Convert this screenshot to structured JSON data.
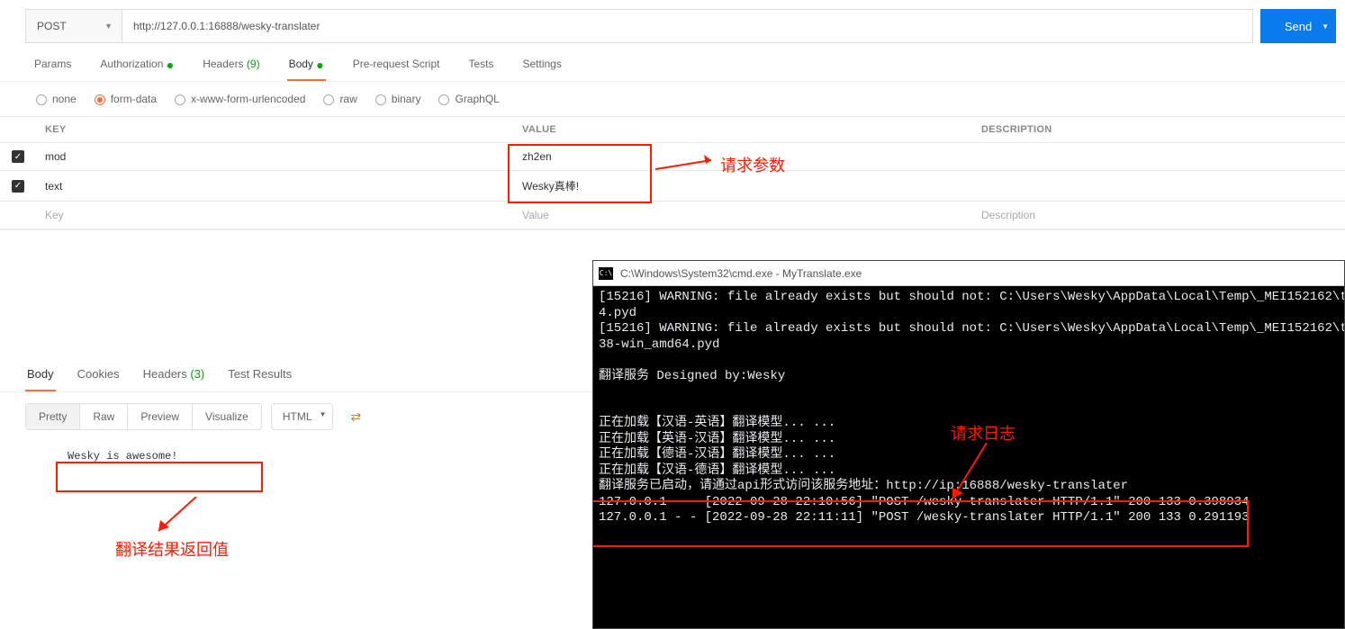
{
  "request": {
    "method": "POST",
    "url": "http://127.0.0.1:16888/wesky-translater",
    "send_label": "Send"
  },
  "tabs": {
    "params": "Params",
    "auth": "Authorization",
    "headers": "Headers",
    "headers_count": "(9)",
    "body": "Body",
    "prereq": "Pre-request Script",
    "tests": "Tests",
    "settings": "Settings"
  },
  "body_types": {
    "none": "none",
    "form_data": "form-data",
    "xwww": "x-www-form-urlencoded",
    "raw": "raw",
    "binary": "binary",
    "graphql": "GraphQL"
  },
  "param_headers": {
    "key": "KEY",
    "value": "VALUE",
    "desc": "DESCRIPTION"
  },
  "param_rows": [
    {
      "key": "mod",
      "value": "zh2en"
    },
    {
      "key": "text",
      "value": "Wesky真棒!"
    }
  ],
  "param_placeholders": {
    "key": "Key",
    "value": "Value",
    "desc": "Description"
  },
  "annotations": {
    "req_params": "请求参数",
    "resp_result": "翻译结果返回值",
    "req_log": "请求日志"
  },
  "response_tabs": {
    "body": "Body",
    "cookies": "Cookies",
    "headers": "Headers",
    "headers_count": "(3)",
    "test_results": "Test Results"
  },
  "views": {
    "pretty": "Pretty",
    "raw": "Raw",
    "preview": "Preview",
    "visualize": "Visualize",
    "format": "HTML"
  },
  "response": {
    "body": "Wesky is awesome!"
  },
  "terminal": {
    "title": "C:\\Windows\\System32\\cmd.exe - MyTranslate.exe",
    "lines": "[15216] WARNING: file already exists but should not: C:\\Users\\Wesky\\AppData\\Local\\Temp\\_MEI152162\\torch\\_\n4.pyd\n[15216] WARNING: file already exists but should not: C:\\Users\\Wesky\\AppData\\Local\\Temp\\_MEI152162\\torch\\_\n38-win_amd64.pyd\n\n翻译服务 Designed by:Wesky\n\n\n正在加载【汉语-英语】翻译模型... ...\n正在加载【英语-汉语】翻译模型... ...\n正在加载【德语-汉语】翻译模型... ...\n正在加载【汉语-德语】翻译模型... ...\n翻译服务已启动，请通过api形式访问该服务地址：http://ip:16888/wesky-translater\n127.0.0.1 - - [2022-09-28 22:10:56] \"POST /wesky-translater HTTP/1.1\" 200 133 0.398934\n127.0.0.1 - - [2022-09-28 22:11:11] \"POST /wesky-translater HTTP/1.1\" 200 133 0.291193"
  }
}
